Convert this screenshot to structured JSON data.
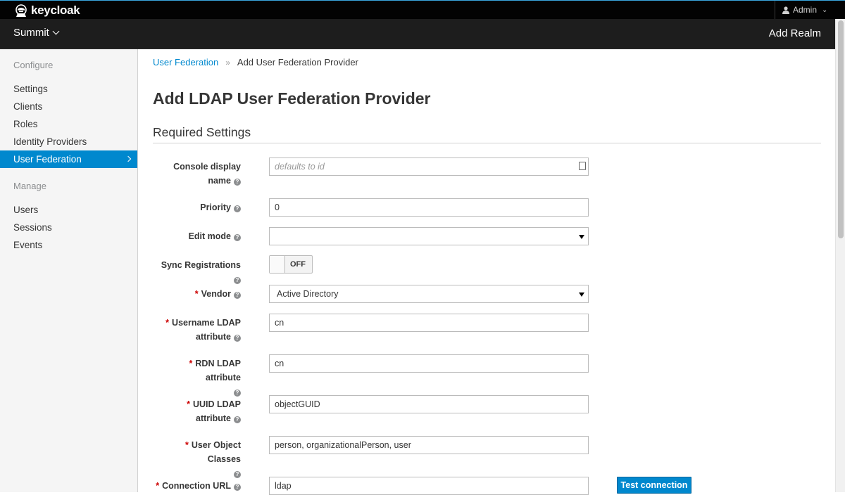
{
  "header": {
    "brand": "keycloak",
    "user": "Admin",
    "realm": "Summit",
    "add_realm": "Add Realm"
  },
  "sidebar": {
    "configure_heading": "Configure",
    "configure_items": [
      {
        "label": "Settings"
      },
      {
        "label": "Clients"
      },
      {
        "label": "Roles"
      },
      {
        "label": "Identity Providers"
      },
      {
        "label": "User Federation",
        "active": true
      }
    ],
    "manage_heading": "Manage",
    "manage_items": [
      {
        "label": "Users"
      },
      {
        "label": "Sessions"
      },
      {
        "label": "Events"
      }
    ]
  },
  "breadcrumb": {
    "parent": "User Federation",
    "separator": "»",
    "current": "Add User Federation Provider"
  },
  "page_title": "Add LDAP User Federation Provider",
  "section_title": "Required Settings",
  "help_glyph": "?",
  "required_mark": "*",
  "form": {
    "console_display_name": {
      "label_line1": "Console display",
      "label_line2": "name",
      "value": "",
      "placeholder": "defaults to id"
    },
    "priority": {
      "label": "Priority",
      "value": "0"
    },
    "edit_mode": {
      "label": "Edit mode",
      "value": ""
    },
    "sync_registrations": {
      "label": "Sync Registrations",
      "state": "OFF"
    },
    "vendor": {
      "label": "Vendor",
      "value": "Active Directory",
      "required": true
    },
    "username_ldap_attribute": {
      "label_line1": "Username LDAP",
      "label_line2": "attribute",
      "value": "cn",
      "required": true
    },
    "rdn_ldap_attribute": {
      "label": "RDN LDAP attribute",
      "value": "cn",
      "required": true
    },
    "uuid_ldap_attribute": {
      "label_line1": "UUID LDAP",
      "label_line2": "attribute",
      "value": "objectGUID",
      "required": true
    },
    "user_object_classes": {
      "label": "User Object Classes",
      "value": "person, organizationalPerson, user",
      "required": true
    },
    "connection_url": {
      "label": "Connection URL",
      "value": "ldap",
      "required": true
    },
    "test_connection_label": "Test connection"
  },
  "colors": {
    "accent": "#0088ce",
    "top_bar": "#030303",
    "second_bar": "#1d1d1d",
    "required": "#cc0000"
  }
}
